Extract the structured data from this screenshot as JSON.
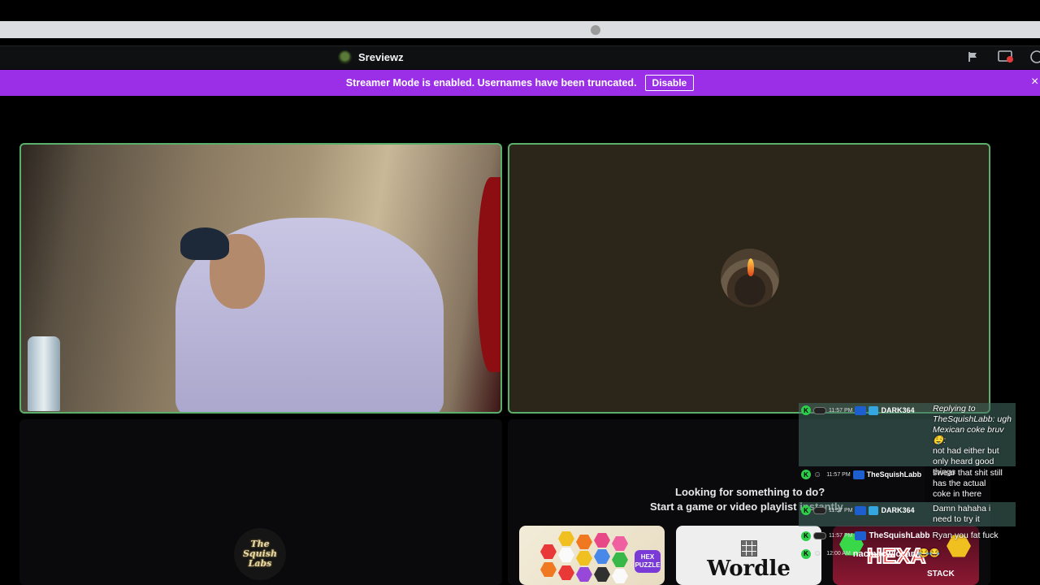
{
  "header": {
    "channel_name": "Sreviewz"
  },
  "banner": {
    "text": "Streamer Mode is enabled. Usernames have been truncated.",
    "button_label": "Disable",
    "close_glyph": "×"
  },
  "colors": {
    "banner": "#9b2fe8",
    "speaking_border": "#5ab06a",
    "chat_badge": "#2ccf4a"
  },
  "activity": {
    "line1": "Looking for something to do?",
    "line2": "Start a game or video playlist instantly",
    "cards": [
      {
        "badge_line1": "HEX",
        "badge_line2": "PUZZLE"
      },
      {
        "title": "Wordle"
      },
      {
        "title": "HEXA",
        "subtitle": "STACK"
      }
    ]
  },
  "logo": {
    "text_line1": "The",
    "text_line2": "Squish",
    "text_line3": "Labs"
  },
  "chat": {
    "messages": [
      {
        "badge": "K",
        "time": "11:57 PM",
        "user": "DARK364",
        "reply_prefix": "Replying to",
        "reply_text": "TheSquishLabb: ugh Mexican coke bruv🤤:",
        "text_line1": "not had either but",
        "text_line2": "only heard good",
        "text_line3": "things"
      },
      {
        "badge": "K",
        "time": "11:57 PM",
        "user": "TheSquishLabb",
        "text_line1": "swear that shit still",
        "text_line2": "has the actual",
        "text_line3": "coke in there"
      },
      {
        "badge": "K",
        "time": "11:57 PM",
        "user": "DARK364",
        "text_line1": "Damn hahaha i",
        "text_line2": "need to try it"
      },
      {
        "badge": "K",
        "time": "11:57 PM",
        "user": "TheSquishLabb",
        "text": "Ryan you fat fuck"
      },
      {
        "badge": "K",
        "time": "12:00 AM",
        "user": "nacmacwiccan",
        "text": "😂😂"
      }
    ]
  }
}
